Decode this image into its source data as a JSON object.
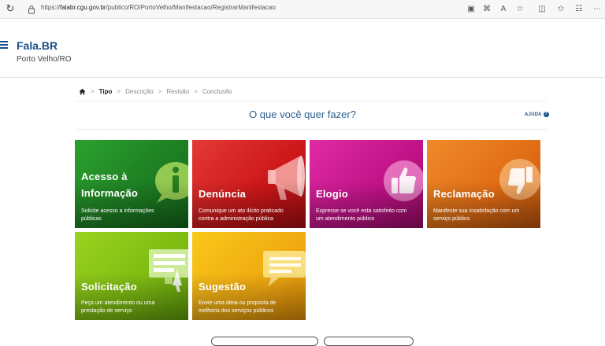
{
  "browser": {
    "url_prefix": "https://",
    "url_host": "falabr.cgu.gov.br",
    "url_path": "/publico/RO/PortoVelho/Manifestacao/RegistrarManifestacao",
    "icons": [
      "reload-icon",
      "lock-icon",
      "screen-cast-icon",
      "extensions-grid-icon",
      "read-aloud-icon",
      "favorite-star-icon",
      "split-screen-icon",
      "favorites-icon",
      "collections-icon",
      "more-icon"
    ]
  },
  "header": {
    "brand": "Fala.BR",
    "location": "Porto Velho/RO"
  },
  "breadcrumb": {
    "steps": [
      "Tipo",
      "Descrição",
      "Revisão",
      "Conclusão"
    ]
  },
  "page": {
    "title": "O que você quer fazer?",
    "help": "AJUDA"
  },
  "tiles": [
    {
      "title_line1": "Acesso à",
      "title_line2": "Informação",
      "desc_line1": "Solicite acesso a informações",
      "desc_line2": "públicas",
      "color": "#1d7d22",
      "icon": "info-icon"
    },
    {
      "title_line1": "Denúncia",
      "desc_line1": "Comunique um ato ilícito praticado",
      "desc_line2": "contra a administração pública",
      "color": "#cc1618",
      "icon": "megaphone-icon"
    },
    {
      "title_line1": "Elogio",
      "desc_line1": "Expresse se você está satisfeito com",
      "desc_line2": "um atendimento público",
      "color": "#bf1286",
      "icon": "thumbs-up-icon"
    },
    {
      "title_line1": "Reclamação",
      "desc_line1": "Manifeste sua insatisfação com um",
      "desc_line2": "serviço público",
      "color": "#e06c14",
      "icon": "thumbs-down-icon"
    },
    {
      "title_line1": "Solicitação",
      "desc_line1": "Peça um atendimento ou uma",
      "desc_line2": "prestação de serviço",
      "color": "#7dbb12",
      "icon": "form-screen-icon"
    },
    {
      "title_line1": "Sugestão",
      "desc_line1": "Envie uma ideia ou proposta de",
      "desc_line2": "melhoria dos serviços públicos",
      "color": "#f0a911",
      "icon": "speech-bubble-icon"
    }
  ]
}
